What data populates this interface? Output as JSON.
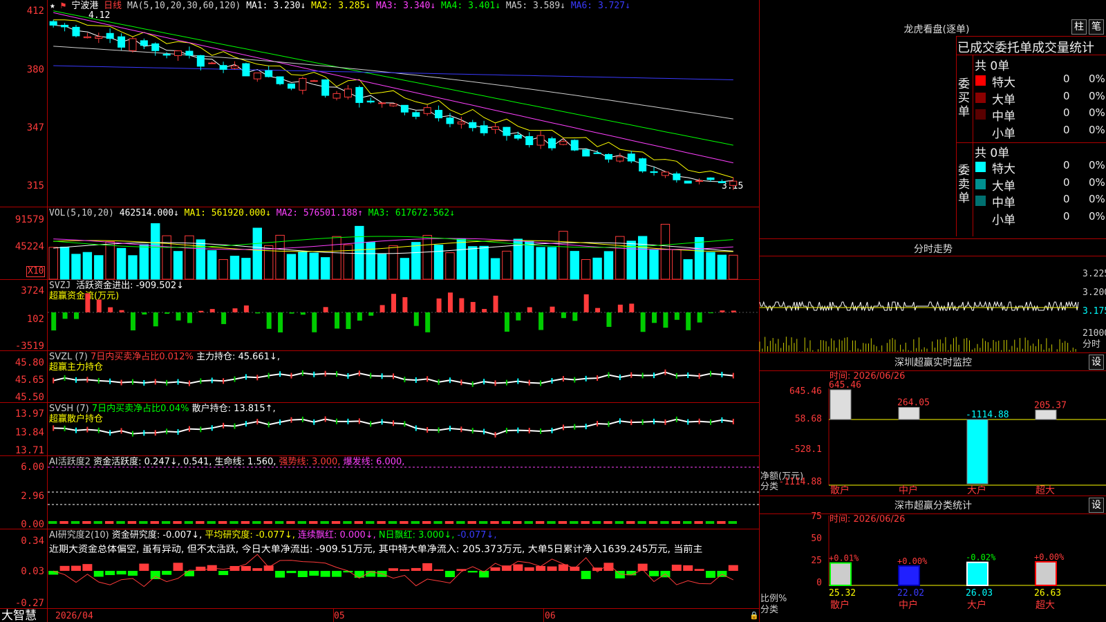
{
  "colors": {
    "up": "#ff3b3b",
    "down": "#00ffff",
    "grid": "#b00000",
    "ma1": "#ffffff",
    "ma2": "#ffff00",
    "ma3": "#ff40ff",
    "ma4": "#00ff00",
    "ma5": "#cfcfcf",
    "ma6": "#3a3aff"
  },
  "icons": {
    "favorite": "star-icon",
    "flag": "flag-icon",
    "lock": "lock-icon"
  },
  "main": {
    "stock_name": "宁波港",
    "period": "日线",
    "ma_label": "MA(5,10,20,30,60,120)",
    "ma": [
      {
        "label": "MA1: 3.230↓",
        "color": "#ffffff"
      },
      {
        "label": "MA2: 3.285↓",
        "color": "#ffff00"
      },
      {
        "label": "MA3: 3.340↓",
        "color": "#ff40ff"
      },
      {
        "label": "MA4: 3.401↓",
        "color": "#00ff00"
      },
      {
        "label": "MA5: 3.589↓",
        "color": "#cfcfcf"
      },
      {
        "label": "MA6: 3.727↓",
        "color": "#3a3aff"
      }
    ],
    "y_ticks": [
      "412",
      "380",
      "347",
      "315"
    ],
    "high_label": "4.12",
    "low_label": "3.15",
    "x_ticks": [
      "2026/04",
      "05",
      "06"
    ]
  },
  "vol": {
    "label": "VOL(5,10,20)",
    "value": "462514.000↓",
    "ma1": "MA1: 561920.000↓",
    "ma2": "MA2: 576501.188↑",
    "ma3": "MA3: 617672.562↓",
    "y_ticks": [
      "91579",
      "45224"
    ],
    "unit": "X10"
  },
  "svzj": {
    "label": "SVZJ",
    "desc": "活跃资金进出: -909.502↓",
    "sub": "超赢资金流(万元)",
    "y_ticks": [
      "3724",
      "102",
      "-3519"
    ]
  },
  "svzl": {
    "label": "SVZL (7)",
    "pct": "7日内买卖净占比0.012%",
    "desc": "主力持仓: 45.661↓,",
    "sub": "超赢主力持仓",
    "y_ticks": [
      "45.80",
      "45.65",
      "45.50"
    ]
  },
  "svsh": {
    "label": "SVSH (7)",
    "pct": "7日内买卖净占比0.04%",
    "desc": "散户持仓: 13.815↑,",
    "sub": "超赢散户持仓",
    "y_ticks": [
      "13.97",
      "13.84",
      "13.71"
    ]
  },
  "ai1": {
    "label": "AI活跃度2",
    "desc": "资金活跃度: 0.247↓, 0.541,",
    "life": "生命线: 1.560,",
    "strong": "强势线: 3.000,",
    "burst": "爆发线: 6.000,",
    "y_ticks": [
      "6.00",
      "2.96",
      "0.00"
    ]
  },
  "ai2": {
    "label": "AI研究度2(10)",
    "desc": "资金研究度: -0.007↓,",
    "avg": "平均研究度: -0.077↓,",
    "red": "连续飘红: 0.000↓,",
    "nred": "N日飘红: 3.000↓,",
    "last": "-0.077↓,",
    "comment": "近期大资金总体偏空, 虽有异动, 但不太活跃, 今日大单净流出: -909.51万元, 其中特大单净流入: 205.373万元, 大单5日累计净入1639.245万元, 当前主",
    "y_ticks": [
      "0.34",
      "0.03",
      "-0.27"
    ]
  },
  "footer_brand": "大智慧",
  "right": {
    "dragon_title": "龙虎看盘(逐单)",
    "btn_bar": "柱",
    "btn_detail": "笔",
    "stats_title": "已成交委托单成交量统计",
    "buy_group": "委买单",
    "sell_group": "委卖单",
    "buy_total": "共 0单",
    "sell_total": "共 0单",
    "buy_rows": [
      {
        "label": "特大",
        "value": "0",
        "pct": "0%",
        "color": "#ff0000"
      },
      {
        "label": "大单",
        "value": "0",
        "pct": "0%",
        "color": "#8b0000"
      },
      {
        "label": "中单",
        "value": "0",
        "pct": "0%",
        "color": "#5a0000"
      },
      {
        "label": "小单",
        "value": "0",
        "pct": "0%",
        "color": "#000000"
      }
    ],
    "sell_rows": [
      {
        "label": "特大",
        "value": "0",
        "pct": "0%",
        "color": "#00ffff"
      },
      {
        "label": "大单",
        "value": "0",
        "pct": "0%",
        "color": "#009090"
      },
      {
        "label": "中单",
        "value": "0",
        "pct": "0%",
        "color": "#007070"
      },
      {
        "label": "小单",
        "value": "0",
        "pct": "0%",
        "color": "#000000"
      }
    ],
    "intraday_title": "分时走势",
    "intraday_ticks": [
      "3.225",
      "3.200",
      "3.175",
      "21000",
      "分时"
    ],
    "monitor_title": "深圳超赢实时监控",
    "monitor_set": "设",
    "monitor_time": "时间: 2026/06/26",
    "monitor_y_ticks": [
      "645.46",
      "58.68",
      "-528.1",
      "-1114.88"
    ],
    "monitor_axis_title": "净额(万元)",
    "monitor_axis_sub": "分类",
    "monitor_bars": [
      {
        "cat": "散户",
        "value": 645.46,
        "label": "645.46"
      },
      {
        "cat": "中户",
        "value": 264.05,
        "label": "264.05"
      },
      {
        "cat": "大户",
        "value": -1114.88,
        "label": "-1114.88"
      },
      {
        "cat": "超大",
        "value": 205.37,
        "label": "205.37"
      }
    ],
    "class_title": "深市超赢分类统计",
    "class_set": "设",
    "class_time": "时间: 2026/06/26",
    "class_y_ticks": [
      "75",
      "50",
      "25",
      "0"
    ],
    "class_axis_title": "比例%",
    "class_axis_sub": "分类",
    "class_bars": [
      {
        "cat": "散户",
        "value": 25.32,
        "label": "25.32",
        "delta": "+0.01%"
      },
      {
        "cat": "中户",
        "value": 22.02,
        "label": "22.02",
        "delta": "+0.00%"
      },
      {
        "cat": "大户",
        "value": 26.03,
        "label": "26.03",
        "delta": "-0.02%"
      },
      {
        "cat": "超大",
        "value": 26.63,
        "label": "26.63",
        "delta": "+0.00%"
      }
    ]
  }
}
